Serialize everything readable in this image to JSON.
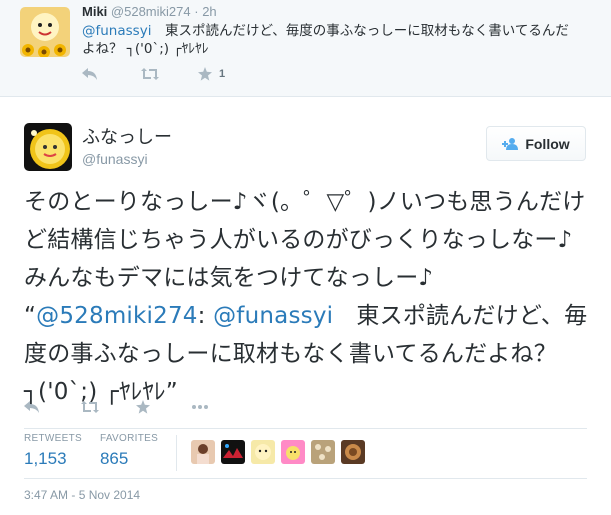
{
  "colors": {
    "link": "#2b7bb9",
    "muted": "#8899a6",
    "icon": "#aab8c2",
    "text": "#292f33"
  },
  "parent_tweet": {
    "name": "Miki",
    "handle": "@528miki274",
    "separator": "·",
    "time": "2h",
    "mention": "@funassyi",
    "text": "　東スポ読んだけど、毎度の事ふなっしーに取材もなく書いてるんだよね？ ┐('0`;) ┌ﾔﾚﾔﾚ",
    "actions": {
      "reply_icon": "reply-icon",
      "retweet_icon": "retweet-icon",
      "favorite_icon": "star-icon",
      "favorite_count": "1"
    }
  },
  "main_tweet": {
    "name": "ふなっしー",
    "handle": "@funassyi",
    "follow_label": "Follow",
    "text_intro": "そのとーりなっしー♪ヾ(。゜▽゜)ノいつも思うんだけど結構信じちゃう人がいるのがびっくりなっしなー♪みんなもデマには気をつけてなっしー♪",
    "quote_open": "“",
    "quote_mention1": "@528miki274",
    "quote_colon": ": ",
    "quote_mention2": "@funassyi",
    "quote_text": "　東スポ読んだけど、毎度の事ふなっしーに取材もなく書いてるんだよね？┐('0`;) ┌ﾔﾚﾔﾚ",
    "quote_close": "”",
    "stats": {
      "retweets_label": "RETWEETS",
      "retweets": "1,153",
      "favorites_label": "FAVORITES",
      "favorites": "865"
    },
    "timestamp": "3:47 AM - 5 Nov 2014"
  }
}
